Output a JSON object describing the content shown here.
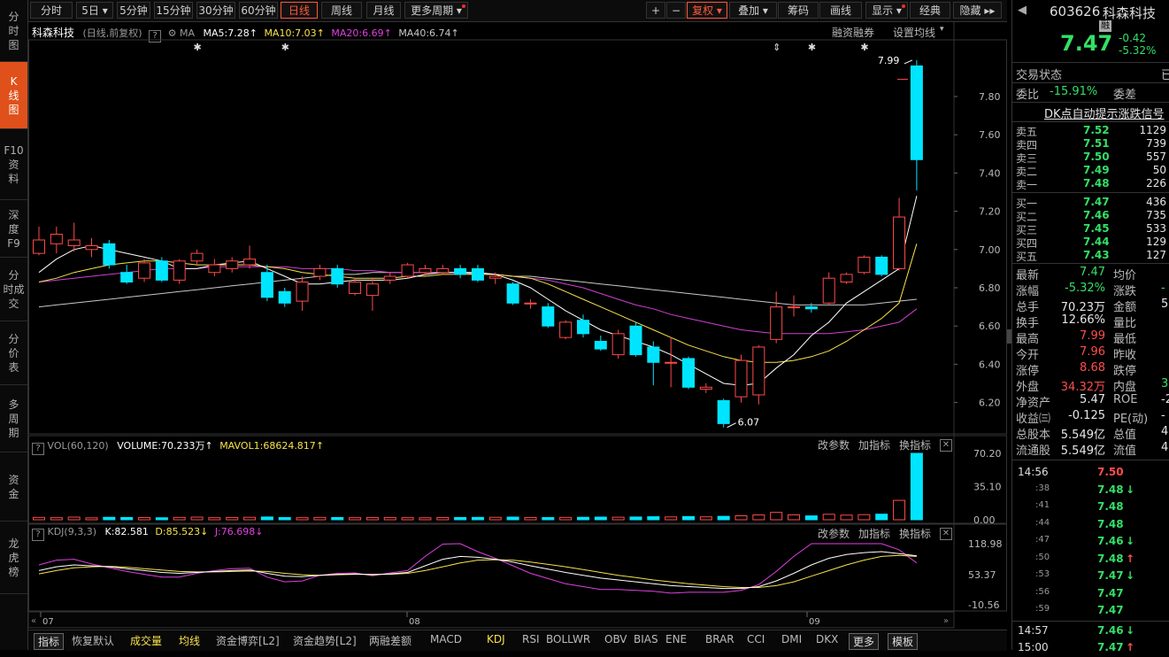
{
  "sidebar": {
    "items": [
      {
        "label": [
          "分",
          "时",
          "图"
        ]
      },
      {
        "label": [
          "K",
          "线",
          "图"
        ]
      },
      {
        "label": [
          "F10",
          "资",
          "料"
        ]
      },
      {
        "label": [
          "深",
          "度",
          "F9"
        ]
      },
      {
        "label": [
          "分",
          "时成",
          "交"
        ]
      },
      {
        "label": [
          "分",
          "价",
          "表"
        ]
      },
      {
        "label": [
          "多",
          "周",
          "期"
        ]
      },
      {
        "label": [
          "资",
          "金"
        ]
      },
      {
        "label": [
          "龙",
          "虎",
          "榜"
        ]
      }
    ]
  },
  "toolbar": {
    "periods": [
      "分时",
      "5日",
      "5分钟",
      "15分钟",
      "30分钟",
      "60分钟",
      "日线",
      "周线",
      "月线",
      "更多周期"
    ],
    "right_btns": [
      "+",
      "−",
      "复权",
      "叠加",
      "筹码",
      "画线",
      "显示",
      "经典",
      "隐藏"
    ]
  },
  "chart": {
    "stock_name": "科森科技",
    "mode": "(日线,前复权)",
    "ma_label": "MA",
    "ma5": "MA5:7.28",
    "ma10": "MA10:7.03",
    "ma20": "MA20:6.69",
    "ma40": "MA40:6.74",
    "link_margin": "融资融券",
    "link_setma": "设置均线",
    "high_label": "7.99",
    "low_label": "6.07",
    "y_ticks": [
      "7.80",
      "7.60",
      "7.40",
      "7.20",
      "7.00",
      "6.80",
      "6.60",
      "6.40",
      "6.20"
    ],
    "vol_title": "VOL(60,120)",
    "vol_value": "VOLUME:70.233万",
    "mavol": "MAVOL1:68624.817",
    "vol_ticks": [
      "70.20",
      "35.10",
      "0.00"
    ],
    "kdj_title": "KDJ(9,3,3)",
    "kdj_k": "K:82.581",
    "kdj_d": "D:85.523",
    "kdj_j": "J:76.698",
    "kdj_ticks": [
      "118.98",
      "53.37",
      "-10.56"
    ],
    "panel_btns": [
      "改参数",
      "加指标",
      "换指标"
    ],
    "x_labels": [
      "07",
      "08",
      "09"
    ]
  },
  "indicators": [
    "指标",
    "恢复默认",
    "成交量",
    "均线",
    "资金博弈[L2]",
    "资金趋势[L2]",
    "两融差额",
    "MACD",
    "KDJ",
    "RSI",
    "BOLL",
    "WR",
    "OBV",
    "BIAS",
    "ENE",
    "BRAR",
    "CCI",
    "DMI",
    "DKX",
    "更多",
    "模板"
  ],
  "quote": {
    "code": "603626",
    "name": "科森科技",
    "badge": "融",
    "price": "7.47",
    "change": "-0.42",
    "change_pct": "-5.32%",
    "status_label": "交易状态",
    "status_value": "已",
    "weibi_label": "委比",
    "weibi_value": "-15.91%",
    "weicha_label": "委差",
    "signal_link": "DK点自动提示涨跌信号",
    "asks": [
      {
        "label": "卖五",
        "price": "7.52",
        "vol": "1129"
      },
      {
        "label": "卖四",
        "price": "7.51",
        "vol": "739"
      },
      {
        "label": "卖三",
        "price": "7.50",
        "vol": "557"
      },
      {
        "label": "卖二",
        "price": "7.49",
        "vol": "50"
      },
      {
        "label": "卖一",
        "price": "7.48",
        "vol": "226"
      }
    ],
    "bids": [
      {
        "label": "买一",
        "price": "7.47",
        "vol": "436"
      },
      {
        "label": "买二",
        "price": "7.46",
        "vol": "735"
      },
      {
        "label": "买三",
        "price": "7.45",
        "vol": "533"
      },
      {
        "label": "买四",
        "price": "7.44",
        "vol": "129"
      },
      {
        "label": "买五",
        "price": "7.43",
        "vol": "127"
      }
    ],
    "stats": [
      {
        "l1": "最新",
        "v1": "7.47",
        "c1": "green",
        "l2": "均价",
        "v2": "",
        "c2": "white"
      },
      {
        "l1": "涨幅",
        "v1": "-5.32%",
        "c1": "green",
        "l2": "涨跌",
        "v2": "-",
        "c2": "green"
      },
      {
        "l1": "总手",
        "v1": "70.23万",
        "c1": "white",
        "l2": "金额",
        "v2": "5",
        "c2": "white"
      },
      {
        "l1": "换手",
        "v1": "12.66%",
        "c1": "white",
        "l2": "量比",
        "v2": "",
        "c2": "white"
      },
      {
        "l1": "最高",
        "v1": "7.99",
        "c1": "red",
        "l2": "最低",
        "v2": "",
        "c2": "green"
      },
      {
        "l1": "今开",
        "v1": "7.96",
        "c1": "red",
        "l2": "昨收",
        "v2": "",
        "c2": "white"
      },
      {
        "l1": "涨停",
        "v1": "8.68",
        "c1": "red",
        "l2": "跌停",
        "v2": "",
        "c2": "green"
      },
      {
        "l1": "外盘",
        "v1": "34.32万",
        "c1": "red",
        "l2": "内盘",
        "v2": "35.",
        "c2": "green"
      },
      {
        "l1": "净资产",
        "v1": "5.47",
        "c1": "white",
        "l2": "ROE",
        "v2": "-2",
        "c2": "white"
      },
      {
        "l1": "收益㈢",
        "v1": "-0.125",
        "c1": "white",
        "l2": "PE(动)",
        "v2": "-",
        "c2": "white"
      },
      {
        "l1": "总股本",
        "v1": "5.549亿",
        "c1": "white",
        "l2": "总值",
        "v2": "41.",
        "c2": "white"
      },
      {
        "l1": "流通股",
        "v1": "5.549亿",
        "c1": "white",
        "l2": "流值",
        "v2": "41.",
        "c2": "white"
      }
    ],
    "ticks": [
      {
        "time": "14:56",
        "price": "7.50",
        "c": "red",
        "arrow": ""
      },
      {
        "time": ":38",
        "price": "7.48",
        "c": "green",
        "arrow": "↓"
      },
      {
        "time": ":41",
        "price": "7.48",
        "c": "green",
        "arrow": ""
      },
      {
        "time": ":44",
        "price": "7.48",
        "c": "green",
        "arrow": ""
      },
      {
        "time": ":47",
        "price": "7.46",
        "c": "green",
        "arrow": "↓"
      },
      {
        "time": ":50",
        "price": "7.48",
        "c": "green",
        "arrow": "↑"
      },
      {
        "time": ":53",
        "price": "7.47",
        "c": "green",
        "arrow": "↓"
      },
      {
        "time": ":56",
        "price": "7.47",
        "c": "green",
        "arrow": ""
      },
      {
        "time": ":59",
        "price": "7.47",
        "c": "green",
        "arrow": ""
      },
      {
        "time": "14:57",
        "price": "7.46",
        "c": "green",
        "arrow": "↓"
      },
      {
        "time": "15:00",
        "price": "7.47",
        "c": "green",
        "arrow": "↑"
      }
    ]
  },
  "chart_data": {
    "type": "candlestick",
    "ylim": [
      6.05,
      8.05
    ],
    "candles": [
      {
        "o": 6.98,
        "c": 7.05,
        "h": 7.12,
        "l": 6.97
      },
      {
        "o": 7.03,
        "c": 7.08,
        "h": 7.12,
        "l": 6.98
      },
      {
        "o": 7.02,
        "c": 7.05,
        "h": 7.14,
        "l": 6.99
      },
      {
        "o": 7.0,
        "c": 7.02,
        "h": 7.06,
        "l": 6.96
      },
      {
        "o": 7.03,
        "c": 6.92,
        "h": 7.05,
        "l": 6.9
      },
      {
        "o": 6.88,
        "c": 6.83,
        "h": 6.92,
        "l": 6.82
      },
      {
        "o": 6.85,
        "c": 6.93,
        "h": 6.95,
        "l": 6.83
      },
      {
        "o": 6.94,
        "c": 6.84,
        "h": 6.96,
        "l": 6.83
      },
      {
        "o": 6.84,
        "c": 6.94,
        "h": 6.95,
        "l": 6.82
      },
      {
        "o": 6.94,
        "c": 6.98,
        "h": 7.0,
        "l": 6.92
      },
      {
        "o": 6.88,
        "c": 6.92,
        "h": 6.95,
        "l": 6.86
      },
      {
        "o": 6.9,
        "c": 6.94,
        "h": 6.96,
        "l": 6.88
      },
      {
        "o": 6.92,
        "c": 6.95,
        "h": 7.02,
        "l": 6.9
      },
      {
        "o": 6.88,
        "c": 6.75,
        "h": 6.92,
        "l": 6.73
      },
      {
        "o": 6.78,
        "c": 6.72,
        "h": 6.8,
        "l": 6.7
      },
      {
        "o": 6.73,
        "c": 6.83,
        "h": 6.86,
        "l": 6.68
      },
      {
        "o": 6.86,
        "c": 6.9,
        "h": 6.92,
        "l": 6.84
      },
      {
        "o": 6.9,
        "c": 6.82,
        "h": 6.92,
        "l": 6.8
      },
      {
        "o": 6.77,
        "c": 6.83,
        "h": 6.85,
        "l": 6.76
      },
      {
        "o": 6.76,
        "c": 6.82,
        "h": 6.85,
        "l": 6.68
      },
      {
        "o": 6.84,
        "c": 6.86,
        "h": 6.88,
        "l": 6.82
      },
      {
        "o": 6.86,
        "c": 6.92,
        "h": 6.93,
        "l": 6.85
      },
      {
        "o": 6.88,
        "c": 6.9,
        "h": 6.92,
        "l": 6.86
      },
      {
        "o": 6.88,
        "c": 6.9,
        "h": 6.92,
        "l": 6.87
      },
      {
        "o": 6.9,
        "c": 6.87,
        "h": 6.92,
        "l": 6.85
      },
      {
        "o": 6.9,
        "c": 6.84,
        "h": 6.92,
        "l": 6.83
      },
      {
        "o": 6.85,
        "c": 6.86,
        "h": 6.88,
        "l": 6.82
      },
      {
        "o": 6.82,
        "c": 6.72,
        "h": 6.83,
        "l": 6.71
      },
      {
        "o": 6.72,
        "c": 6.72,
        "h": 6.74,
        "l": 6.69
      },
      {
        "o": 6.7,
        "c": 6.6,
        "h": 6.72,
        "l": 6.59
      },
      {
        "o": 6.54,
        "c": 6.62,
        "h": 6.63,
        "l": 6.53
      },
      {
        "o": 6.63,
        "c": 6.56,
        "h": 6.66,
        "l": 6.54
      },
      {
        "o": 6.52,
        "c": 6.48,
        "h": 6.55,
        "l": 6.47
      },
      {
        "o": 6.45,
        "c": 6.56,
        "h": 6.58,
        "l": 6.43
      },
      {
        "o": 6.6,
        "c": 6.45,
        "h": 6.62,
        "l": 6.44
      },
      {
        "o": 6.49,
        "c": 6.41,
        "h": 6.52,
        "l": 6.29
      },
      {
        "o": 6.41,
        "c": 6.41,
        "h": 6.54,
        "l": 6.28
      },
      {
        "o": 6.43,
        "c": 6.28,
        "h": 6.44,
        "l": 6.27
      },
      {
        "o": 6.27,
        "c": 6.28,
        "h": 6.3,
        "l": 6.25
      },
      {
        "o": 6.21,
        "c": 6.09,
        "h": 6.22,
        "l": 6.07
      },
      {
        "o": 6.23,
        "c": 6.42,
        "h": 6.45,
        "l": 6.2
      },
      {
        "o": 6.24,
        "c": 6.49,
        "h": 6.5,
        "l": 6.19
      },
      {
        "o": 6.53,
        "c": 6.7,
        "h": 6.78,
        "l": 6.51
      },
      {
        "o": 6.7,
        "c": 6.7,
        "h": 6.76,
        "l": 6.65
      },
      {
        "o": 6.7,
        "c": 6.69,
        "h": 6.72,
        "l": 6.67
      },
      {
        "o": 6.72,
        "c": 6.85,
        "h": 6.88,
        "l": 6.71
      },
      {
        "o": 6.83,
        "c": 6.87,
        "h": 6.88,
        "l": 6.82
      },
      {
        "o": 6.88,
        "c": 6.96,
        "h": 6.97,
        "l": 6.87
      },
      {
        "o": 6.96,
        "c": 6.87,
        "h": 6.97,
        "l": 6.86
      },
      {
        "o": 6.9,
        "c": 7.17,
        "h": 7.27,
        "l": 6.89
      },
      {
        "o": 7.96,
        "c": 7.47,
        "h": 7.99,
        "l": 7.31
      }
    ],
    "ma5": [
      6.88,
      6.95,
      7.0,
      7.02,
      7.0,
      6.98,
      6.96,
      6.94,
      6.9,
      6.9,
      6.92,
      6.93,
      6.94,
      6.9,
      6.86,
      6.82,
      6.82,
      6.83,
      6.84,
      6.84,
      6.84,
      6.85,
      6.87,
      6.88,
      6.88,
      6.88,
      6.87,
      6.84,
      6.8,
      6.74,
      6.68,
      6.63,
      6.58,
      6.55,
      6.52,
      6.49,
      6.45,
      6.4,
      6.35,
      6.3,
      6.29,
      6.3,
      6.38,
      6.45,
      6.55,
      6.62,
      6.72,
      6.78,
      6.84,
      6.9,
      7.28
    ],
    "ma10": [
      6.83,
      6.85,
      6.88,
      6.9,
      6.92,
      6.93,
      6.94,
      6.94,
      6.93,
      6.92,
      6.92,
      6.92,
      6.92,
      6.91,
      6.9,
      6.88,
      6.87,
      6.86,
      6.85,
      6.85,
      6.85,
      6.86,
      6.86,
      6.87,
      6.87,
      6.87,
      6.87,
      6.86,
      6.85,
      6.82,
      6.78,
      6.74,
      6.7,
      6.66,
      6.62,
      6.58,
      6.54,
      6.5,
      6.47,
      6.44,
      6.42,
      6.41,
      6.41,
      6.42,
      6.44,
      6.47,
      6.52,
      6.58,
      6.64,
      6.72,
      7.03
    ],
    "ma20": [
      6.83,
      6.84,
      6.85,
      6.86,
      6.87,
      6.88,
      6.89,
      6.9,
      6.9,
      6.9,
      6.91,
      6.91,
      6.91,
      6.91,
      6.91,
      6.9,
      6.9,
      6.9,
      6.89,
      6.89,
      6.88,
      6.88,
      6.88,
      6.88,
      6.88,
      6.88,
      6.87,
      6.86,
      6.85,
      6.84,
      6.82,
      6.8,
      6.77,
      6.74,
      6.71,
      6.69,
      6.66,
      6.64,
      6.62,
      6.6,
      6.58,
      6.57,
      6.56,
      6.56,
      6.56,
      6.56,
      6.57,
      6.58,
      6.6,
      6.62,
      6.69
    ],
    "ma40": [
      6.7,
      6.71,
      6.72,
      6.73,
      6.74,
      6.75,
      6.76,
      6.77,
      6.78,
      6.79,
      6.8,
      6.81,
      6.82,
      6.83,
      6.84,
      6.85,
      6.86,
      6.87,
      6.87,
      6.88,
      6.88,
      6.88,
      6.88,
      6.88,
      6.88,
      6.87,
      6.87,
      6.86,
      6.86,
      6.85,
      6.84,
      6.83,
      6.82,
      6.81,
      6.8,
      6.79,
      6.78,
      6.77,
      6.76,
      6.75,
      6.74,
      6.73,
      6.72,
      6.71,
      6.71,
      6.71,
      6.71,
      6.71,
      6.72,
      6.73,
      6.74
    ],
    "volume": {
      "ylim": [
        0,
        70.2
      ],
      "values": [
        2.5,
        2.2,
        2.8,
        2.0,
        2.6,
        2.4,
        2.3,
        2.1,
        2.5,
        2.8,
        2.2,
        2.4,
        2.6,
        2.9,
        2.3,
        2.2,
        2.5,
        2.4,
        2.2,
        2.3,
        2.4,
        2.2,
        2.1,
        2.3,
        2.4,
        2.5,
        2.6,
        2.8,
        2.4,
        2.3,
        2.5,
        2.6,
        2.8,
        2.7,
        2.9,
        3.2,
        3.0,
        3.4,
        3.1,
        3.6,
        4.2,
        5.1,
        7.8,
        5.2,
        4.1,
        5.8,
        4.9,
        5.4,
        5.9,
        20.5,
        70.2
      ]
    },
    "kdj": {
      "ylim": [
        -10.56,
        118.98
      ],
      "k": [
        62,
        70,
        74,
        72,
        70,
        66,
        62,
        58,
        56,
        58,
        60,
        62,
        63,
        56,
        50,
        49,
        52,
        54,
        55,
        53,
        55,
        58,
        72,
        86,
        92,
        90,
        86,
        80,
        72,
        65,
        58,
        52,
        46,
        42,
        38,
        34,
        30,
        28,
        26,
        24,
        24,
        28,
        40,
        56,
        74,
        88,
        96,
        100,
        102,
        98,
        93
      ],
      "d": [
        55,
        62,
        68,
        70,
        71,
        69,
        66,
        63,
        60,
        59,
        59,
        60,
        61,
        60,
        56,
        53,
        52,
        53,
        54,
        54,
        54,
        56,
        62,
        70,
        78,
        84,
        85,
        84,
        80,
        75,
        70,
        64,
        58,
        52,
        47,
        42,
        38,
        34,
        31,
        28,
        26,
        26,
        30,
        38,
        50,
        62,
        74,
        84,
        92,
        94,
        92
      ],
      "j": [
        74,
        84,
        86,
        76,
        68,
        60,
        54,
        48,
        48,
        56,
        62,
        66,
        67,
        48,
        38,
        40,
        52,
        56,
        57,
        51,
        57,
        62,
        92,
        118,
        120,
        102,
        88,
        72,
        56,
        45,
        34,
        28,
        22,
        22,
        20,
        18,
        14,
        16,
        16,
        16,
        20,
        32,
        60,
        92,
        122,
        140,
        140,
        132,
        122,
        106,
        78
      ]
    }
  }
}
